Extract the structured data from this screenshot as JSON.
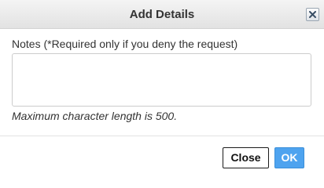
{
  "dialog": {
    "title": "Add Details",
    "close_icon": "close-x-icon"
  },
  "notes": {
    "label": "Notes (*Required only if you deny the request)",
    "value": "",
    "placeholder": "",
    "hint": "Maximum character length is 500."
  },
  "footer": {
    "close_label": "Close",
    "ok_label": "OK"
  },
  "colors": {
    "ok_button": "#4ea3ef",
    "close_button_border": "#1a1a1a",
    "title_text": "#333333"
  }
}
